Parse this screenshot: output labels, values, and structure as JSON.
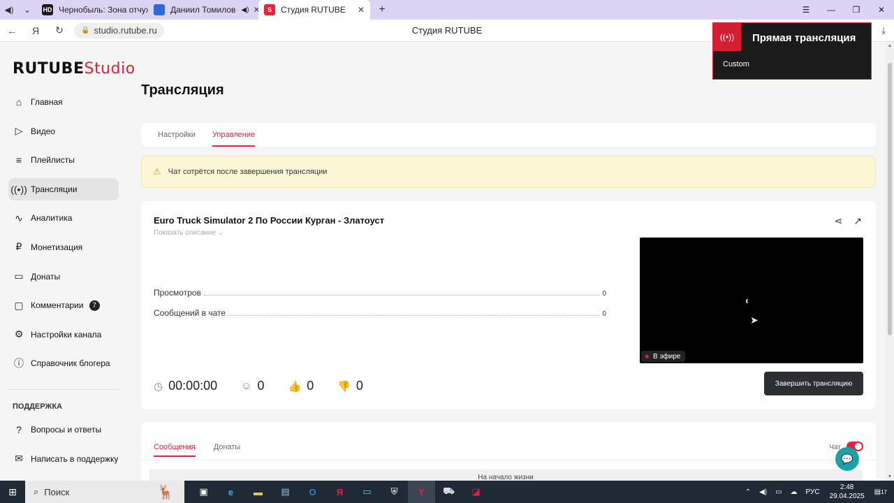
{
  "browser": {
    "tabs": [
      {
        "label": "Чернобыль: Зона отчужд",
        "favicon": "HD",
        "active": false
      },
      {
        "label": "Даниил Томилов",
        "favicon": "VK",
        "active": false
      },
      {
        "label": "Студия RUTUBE",
        "favicon": "S",
        "active": true
      }
    ],
    "url": "studio.rutube.ru",
    "page_title": "Студия RUTUBE"
  },
  "notification": {
    "title": "Прямая трансляция",
    "subtitle": "Custom"
  },
  "logo": {
    "main": "RUTUBE",
    "suffix": "Studio"
  },
  "sidebar": {
    "items": [
      {
        "label": "Главная",
        "icon": "home-icon"
      },
      {
        "label": "Видео",
        "icon": "video-icon"
      },
      {
        "label": "Плейлисты",
        "icon": "playlist-icon"
      },
      {
        "label": "Трансляции",
        "icon": "broadcast-icon",
        "active": true
      },
      {
        "label": "Аналитика",
        "icon": "analytics-icon"
      },
      {
        "label": "Монетизация",
        "icon": "ruble-icon"
      },
      {
        "label": "Донаты",
        "icon": "wallet-icon"
      },
      {
        "label": "Комментарии",
        "icon": "comment-icon",
        "badge": "7"
      },
      {
        "label": "Настройки канала",
        "icon": "gear-icon"
      },
      {
        "label": "Справочник блогера",
        "icon": "info-icon"
      }
    ],
    "support_heading": "ПОДДЕРЖКА",
    "support_items": [
      {
        "label": "Вопросы и ответы",
        "icon": "question-icon"
      },
      {
        "label": "Написать в поддержку",
        "icon": "mail-icon"
      }
    ]
  },
  "main": {
    "heading": "Трансляция",
    "tabs": [
      {
        "label": "Настройки",
        "active": false
      },
      {
        "label": "Управление",
        "active": true
      }
    ],
    "warning": "Чат сотрётся после завершения трансляции",
    "stream": {
      "title": "Euro Truck Simulator 2 По России Курган - Златоуст",
      "show_description": "Показать описание",
      "stats": [
        {
          "label": "Просмотров",
          "value": "0"
        },
        {
          "label": "Сообщений в чате",
          "value": "0"
        }
      ],
      "live_label": "В эфире",
      "timer": "00:00:00",
      "viewers": "0",
      "likes": "0",
      "dislikes": "0",
      "end_button": "Завершить трансляцию"
    },
    "chat": {
      "tabs": [
        {
          "label": "Сообщения",
          "active": true
        },
        {
          "label": "Донаты",
          "active": false
        }
      ],
      "toggle_label": "Чат",
      "toggle_on": true,
      "empty_text": "На начало жизни"
    }
  },
  "taskbar": {
    "search_placeholder": "Поиск",
    "language": "РУС",
    "time": "2:48",
    "date": "29.04.2025",
    "notifications": "17"
  },
  "colors": {
    "accent": "#e8203a",
    "dark_button": "#2b2f33",
    "warning_bg": "#fbf6d6"
  }
}
